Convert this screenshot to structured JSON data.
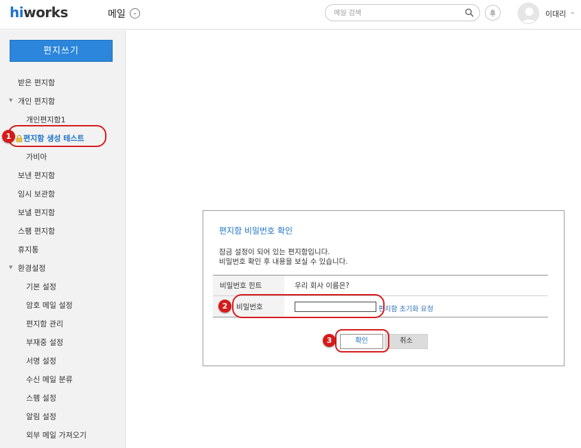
{
  "header": {
    "logo_hi": "hi",
    "logo_rest": "works",
    "app_title": "메일",
    "search_placeholder": "메일 검색",
    "username": "이대리"
  },
  "sidebar": {
    "compose_label": "편지쓰기",
    "items": [
      {
        "label": "받은 편지함"
      },
      {
        "label": "개인 편지함",
        "expanded": true
      },
      {
        "label": "개인편지함1"
      },
      {
        "label": "편지함 생성 테스트",
        "locked": true,
        "active": true
      },
      {
        "label": "가비아"
      },
      {
        "label": "보낸 편지함"
      },
      {
        "label": "임시 보관함"
      },
      {
        "label": "보낼 편지함"
      },
      {
        "label": "스팸 편지함"
      },
      {
        "label": "휴지통"
      },
      {
        "label": "환경설정",
        "expanded": true
      },
      {
        "label": "기본 설정"
      },
      {
        "label": "암호 메일 설정"
      },
      {
        "label": "편지함 관리"
      },
      {
        "label": "부재중 설정"
      },
      {
        "label": "서명 설정"
      },
      {
        "label": "수신 메일 분류"
      },
      {
        "label": "스팸 설정"
      },
      {
        "label": "알림 설정"
      },
      {
        "label": "외부 메일 가져오기"
      }
    ]
  },
  "dialog": {
    "title": "편지함 비밀번호 확인",
    "desc_line1": "잠금 설정이 되어 있는 편지함입니다.",
    "desc_line2": "비밀번호 확인 후 내용을 보실 수 있습니다.",
    "hint_label": "비밀번호 힌트",
    "hint_value": "우리 회사 이름은?",
    "password_label": "비밀번호",
    "password_value": "",
    "reset_link": "편지함 초기화 요청",
    "ok_label": "확인",
    "cancel_label": "취소"
  },
  "annotations": [
    "1",
    "2",
    "3"
  ],
  "colors": {
    "accent": "#1e73c8",
    "compose_button": "#2b86dc",
    "callout": "#d51a1a",
    "sidebar_bg": "#f2f2f2"
  },
  "icons": [
    "search-icon",
    "bell-icon",
    "avatar-icon",
    "chevron-down-icon",
    "lock-icon",
    "collapse-arrow-icon"
  ]
}
